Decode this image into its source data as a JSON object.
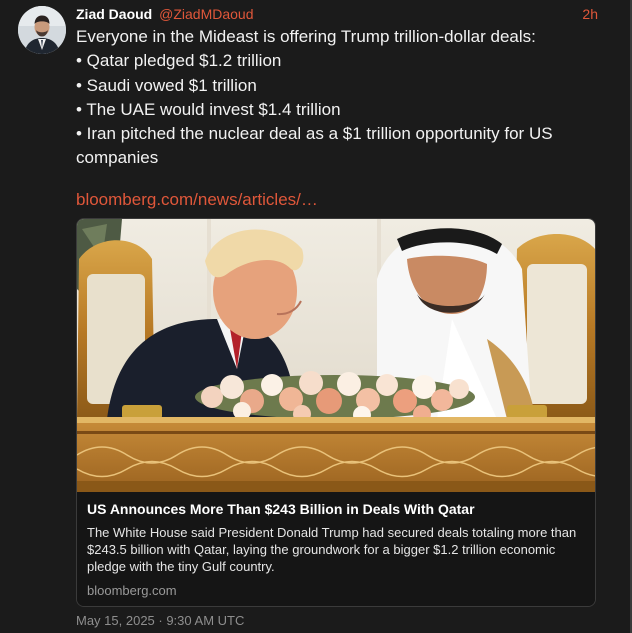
{
  "author": {
    "name": "Ziad Daoud",
    "handle": "@ZiadMDaoud",
    "time_ago": "2h"
  },
  "tweet": {
    "intro": "Everyone in the Mideast is offering Trump trillion-dollar deals:",
    "bullets": [
      "• Qatar pledged $1.2 trillion",
      "• Saudi vowed $1 trillion",
      "• The UAE would invest $1.4 trillion",
      "• Iran pitched the nuclear deal as a $1 trillion opportunity for US companies"
    ],
    "link_text": "bloomberg.com/news/articles/…"
  },
  "card": {
    "title": "US Announces More Than $243 Billion in Deals With Qatar",
    "description": "The White House said President Donald Trump had secured deals totaling more than $243.5 billion with Qatar, laying the groundwork for a bigger $1.2 trillion economic pledge with the tiny Gulf country.",
    "domain": "bloomberg.com"
  },
  "timestamp": "May 15, 2025 · 9:30 AM UTC",
  "colors": {
    "background": "#1b1b1b",
    "accent": "#e0573a",
    "text": "#f2f2f2",
    "muted": "#8e8e8e"
  }
}
